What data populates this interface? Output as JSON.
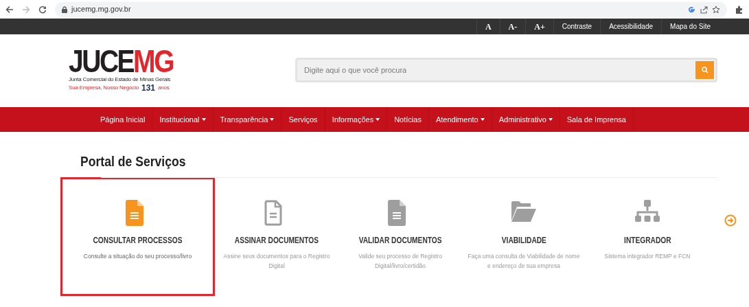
{
  "browser": {
    "url": "jucemg.mg.gov.br"
  },
  "top_bar": {
    "items": [
      {
        "label": "A",
        "kind": "font"
      },
      {
        "label": "A-",
        "kind": "font"
      },
      {
        "label": "A+",
        "kind": "font"
      },
      {
        "label": "Contraste",
        "kind": "link"
      },
      {
        "label": "Acessibilidade",
        "kind": "link"
      },
      {
        "label": "Mapa do Site",
        "kind": "link"
      }
    ]
  },
  "logo": {
    "name_dark": "JUCE",
    "name_red": "MG",
    "subtitle": "Junta Comercial do Estado de Minas Gerais",
    "tagline": "Sua Empresa, Nosso Negócio",
    "years": "131",
    "years_label": "anos"
  },
  "search": {
    "placeholder": "Digite aqui o que você procura"
  },
  "nav": [
    {
      "label": "Página Inicial",
      "dropdown": false
    },
    {
      "label": "Institucional",
      "dropdown": true
    },
    {
      "label": "Transparência",
      "dropdown": true
    },
    {
      "label": "Serviços",
      "dropdown": false
    },
    {
      "label": "Informações",
      "dropdown": true
    },
    {
      "label": "Notícias",
      "dropdown": false
    },
    {
      "label": "Atendimento",
      "dropdown": true
    },
    {
      "label": "Administrativo",
      "dropdown": true
    },
    {
      "label": "Sala de Imprensa",
      "dropdown": false
    }
  ],
  "section_title": "Portal de Serviços",
  "services": [
    {
      "kind": "file-lines",
      "title": "CONSULTAR PROCESSOS",
      "description": "Consulte a situação do seu processo/livro",
      "selected": true
    },
    {
      "kind": "file-outline",
      "title": "ASSINAR DOCUMENTOS",
      "description": "Assine seus documentos para o Registro Digital",
      "selected": false
    },
    {
      "kind": "file-lines",
      "title": "VALIDAR DOCUMENTOS",
      "description": "Valide seu processo de Registro Digital/livro/certidão",
      "selected": false
    },
    {
      "kind": "folder",
      "title": "VIABILIDADE",
      "description": "Faça uma consulta de Viabilidade de nome e endereço de sua empresa",
      "selected": false
    },
    {
      "kind": "sitemap",
      "title": "INTEGRADOR",
      "description": "Sistema integrador REMP e FCN",
      "selected": false
    }
  ]
}
